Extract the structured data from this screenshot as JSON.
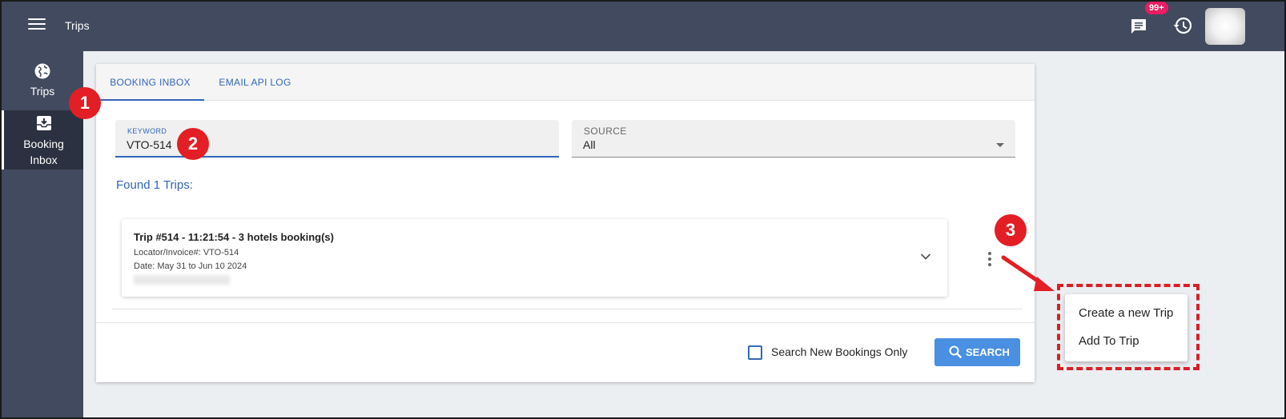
{
  "header": {
    "title": "Trips",
    "notification_badge": "99+",
    "icons": [
      "menu-icon",
      "chat-icon",
      "history-icon",
      "avatar"
    ]
  },
  "sidebar": {
    "items": [
      {
        "label": "Trips",
        "icon": "globe-icon"
      },
      {
        "label_line1": "Booking",
        "label_line2": "Inbox",
        "icon": "inbox-download-icon"
      }
    ]
  },
  "tabs": [
    {
      "label": "BOOKING INBOX"
    },
    {
      "label": "EMAIL API LOG"
    }
  ],
  "filters": {
    "keyword": {
      "label": "KEYWORD",
      "value": "VTO-514"
    },
    "source": {
      "label": "SOURCE",
      "value": "All"
    }
  },
  "results": {
    "found_text": "Found 1 Trips:",
    "trips": [
      {
        "title": "Trip #514 - 11:21:54 - 3 hotels booking(s)",
        "locator": "Locator/Invoice#: VTO-514",
        "date": "Date: May 31 to Jun 10 2024"
      }
    ]
  },
  "footer": {
    "checkbox_label": "Search New Bookings Only",
    "search_button": "SEARCH"
  },
  "context_menu": {
    "items": [
      {
        "label": "Create a new Trip"
      },
      {
        "label": "Add To Trip"
      }
    ]
  },
  "annotations": {
    "step1": "1",
    "step2": "2",
    "step3": "3"
  },
  "colors": {
    "topbar": "#414a5e",
    "accent": "#3366b8",
    "button": "#4a90e2",
    "callout": "#d91f26",
    "badge": "#e91e63"
  }
}
